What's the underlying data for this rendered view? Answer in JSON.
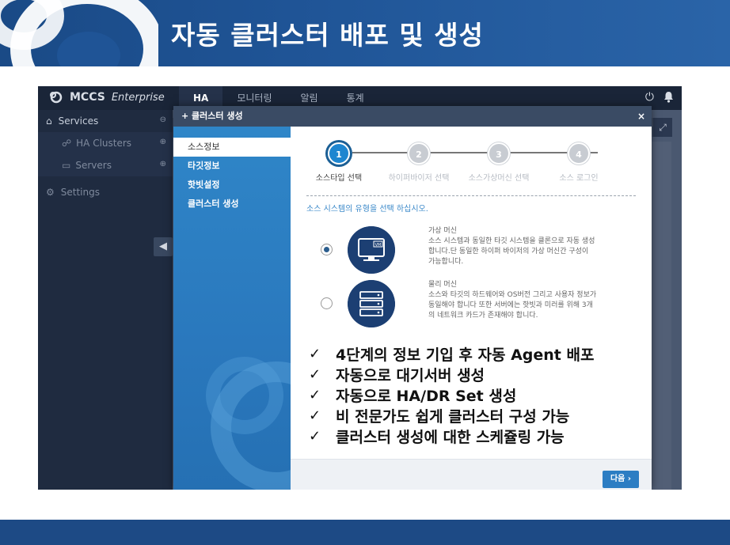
{
  "slide": {
    "title": "자동 클러스터 배포 및 생성"
  },
  "app": {
    "logo": {
      "brand": "MCCS",
      "edition": "Enterprise"
    },
    "nav_tabs": [
      "HA",
      "모니터링",
      "알림",
      "통계"
    ],
    "sidebar": {
      "services": "Services",
      "ha_clusters": "HA Clusters",
      "servers": "Servers",
      "settings": "Settings"
    },
    "modal": {
      "title": "+ 클러스터 생성",
      "close": "×",
      "side_items": [
        "소스정보",
        "타깃정보",
        "핫빗설정",
        "클러스터 생성"
      ],
      "steps": [
        {
          "num": "1",
          "label": "소스타입 선택"
        },
        {
          "num": "2",
          "label": "하이퍼바이저 선택"
        },
        {
          "num": "3",
          "label": "소스가상머신 선택"
        },
        {
          "num": "4",
          "label": "소스 로그인"
        }
      ],
      "instruction": "소스 시스템의 유형을 선택 하십시오.",
      "options": [
        {
          "title": "가상 머신",
          "desc1": "소스 시스템과 동일한 타깃 시스템을 클론으로 자동 생성",
          "desc2": "합니다.단 동일한 하이퍼 바이저의 가상 머신간 구성이",
          "desc3": "가능합니다.",
          "selected": true,
          "icon": "vm-monitor-icon"
        },
        {
          "title": "물리 머신",
          "desc1": "소스와 타깃의 하드웨어와 OS버전 그리고 사용자 정보가",
          "desc2": "동일해야 합니다 또한 서버에는 핫빗과 미러를 위해 3개",
          "desc3": "의 네트워크 카드가 존재해야 합니다.",
          "selected": false,
          "icon": "server-rack-icon"
        }
      ],
      "next_button": "다음 ›"
    }
  },
  "checklist": [
    "4단계의 정보 기입 후 자동 Agent 배포",
    "자동으로 대기서버 생성",
    "자동으로 HA/DR Set 생성",
    "비 전문가도 쉽게 클러스터 구성 가능",
    "클러스터 생성에 대한 스케쥴링 가능"
  ],
  "check_glyph": "✓",
  "colors": {
    "banner": "#1f5496",
    "app_bg": "#2b3a52",
    "modal_side": "#2a78bd",
    "accent": "#1e86d0",
    "icon_circle": "#1c3f73"
  }
}
